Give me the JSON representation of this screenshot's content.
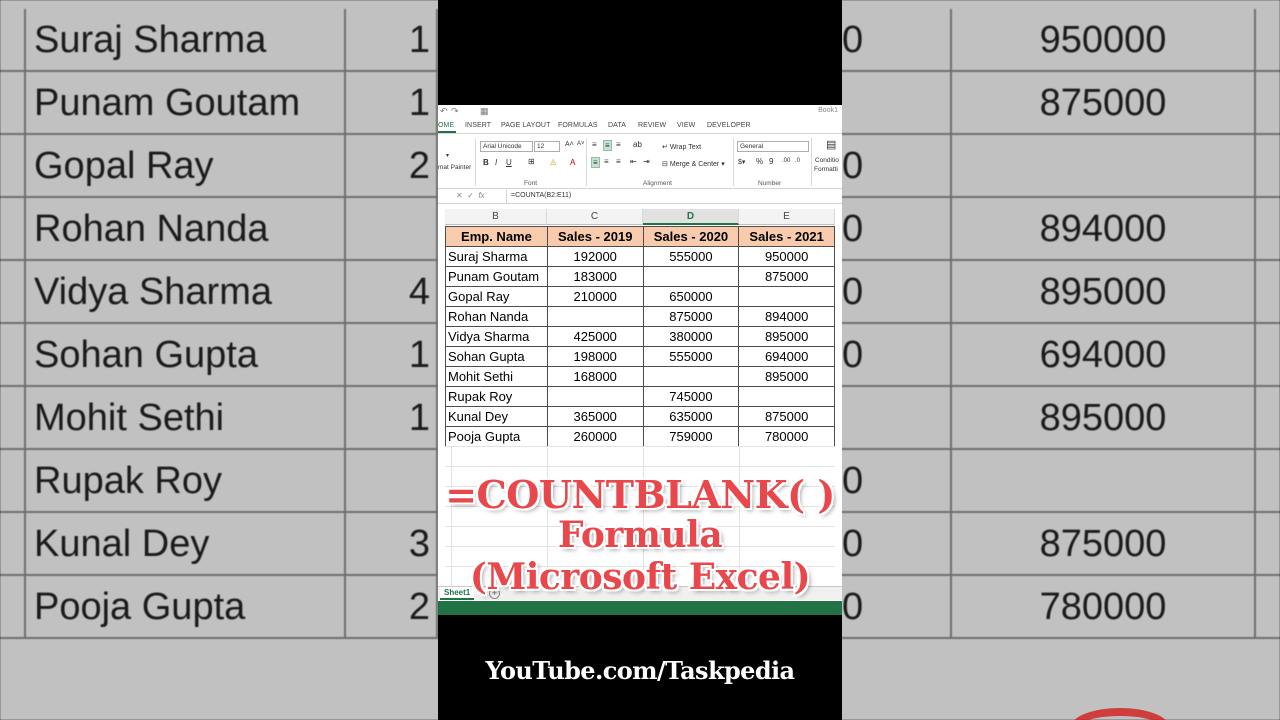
{
  "background": {
    "rows": [
      {
        "name": "Suraj Sharma",
        "c": "1",
        "d": "0",
        "e": "950000"
      },
      {
        "name": "Punam Goutam",
        "c": "1",
        "d": "",
        "e": "875000"
      },
      {
        "name": "Gopal Ray",
        "c": "2",
        "d": "0",
        "e": ""
      },
      {
        "name": "Rohan Nanda",
        "c": "",
        "d": "0",
        "e": "894000"
      },
      {
        "name": "Vidya Sharma",
        "c": "4",
        "d": "0",
        "e": "895000"
      },
      {
        "name": "Sohan Gupta",
        "c": "1",
        "d": "0",
        "e": "694000"
      },
      {
        "name": "Mohit Sethi",
        "c": "1",
        "d": "",
        "e": "895000"
      },
      {
        "name": "Rupak Roy",
        "c": "",
        "d": "0",
        "e": ""
      },
      {
        "name": "Kunal Dey",
        "c": "3",
        "d": "0",
        "e": "875000"
      },
      {
        "name": "Pooja Gupta",
        "c": "2",
        "d": "0",
        "e": "780000"
      }
    ]
  },
  "excel": {
    "book_title": "Book1",
    "tabs": [
      "OME",
      "INSERT",
      "PAGE LAYOUT",
      "FORMULAS",
      "DATA",
      "REVIEW",
      "VIEW",
      "DEVELOPER"
    ],
    "ribbon": {
      "format_painter": "mat Painter",
      "font_name": "Arial Unicode",
      "font_size": "12",
      "wrap_text": "Wrap Text",
      "merge_center": "Merge & Center",
      "number_format": "General",
      "conditional": "Conditio",
      "formatting": "Formatti",
      "group_font": "Font",
      "group_alignment": "Alignment",
      "group_number": "Number",
      "bold": "B",
      "italic": "I",
      "underline": "U",
      "percent": "%",
      "comma": "9"
    },
    "formula_bar": {
      "formula": "=COUNTA(B2:E11)",
      "fx": "fx"
    },
    "columns": [
      "B",
      "C",
      "D",
      "E"
    ],
    "active_column": "D",
    "headers": [
      "Emp. Name",
      "Sales - 2019",
      "Sales - 2020",
      "Sales - 2021"
    ],
    "rows": [
      [
        "Suraj Sharma",
        "192000",
        "555000",
        "950000"
      ],
      [
        "Punam Goutam",
        "183000",
        "",
        "875000"
      ],
      [
        "Gopal Ray",
        "210000",
        "650000",
        ""
      ],
      [
        "Rohan Nanda",
        "",
        "875000",
        "894000"
      ],
      [
        "Vidya Sharma",
        "425000",
        "380000",
        "895000"
      ],
      [
        "Sohan Gupta",
        "198000",
        "555000",
        "694000"
      ],
      [
        "Mohit Sethi",
        "168000",
        "",
        "895000"
      ],
      [
        "Rupak Roy",
        "",
        "745000",
        ""
      ],
      [
        "Kunal Dey",
        "365000",
        "635000",
        "875000"
      ],
      [
        "Pooja Gupta",
        "260000",
        "759000",
        "780000"
      ]
    ],
    "sheet_tab": "Sheet1",
    "add_sheet": "+"
  },
  "overlay": {
    "line1": "=COUNTBLANK( )",
    "line2": "Formula",
    "line3": "(Microsoft Excel)"
  },
  "credit": "YouTube.com/Taskpedia",
  "colors": {
    "excel_green": "#217346",
    "header_fill": "#f8cbad",
    "overlay_red": "#e8474c"
  }
}
